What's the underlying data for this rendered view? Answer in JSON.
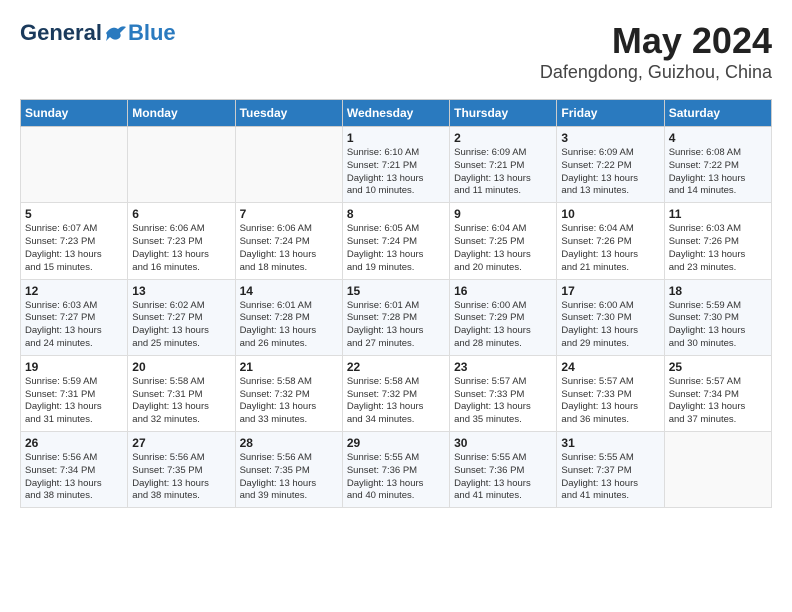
{
  "header": {
    "logo_general": "General",
    "logo_blue": "Blue",
    "title": "May 2024",
    "location": "Dafengdong, Guizhou, China"
  },
  "days_of_week": [
    "Sunday",
    "Monday",
    "Tuesday",
    "Wednesday",
    "Thursday",
    "Friday",
    "Saturday"
  ],
  "weeks": [
    [
      {
        "day": "",
        "info": ""
      },
      {
        "day": "",
        "info": ""
      },
      {
        "day": "",
        "info": ""
      },
      {
        "day": "1",
        "info": "Sunrise: 6:10 AM\nSunset: 7:21 PM\nDaylight: 13 hours\nand 10 minutes."
      },
      {
        "day": "2",
        "info": "Sunrise: 6:09 AM\nSunset: 7:21 PM\nDaylight: 13 hours\nand 11 minutes."
      },
      {
        "day": "3",
        "info": "Sunrise: 6:09 AM\nSunset: 7:22 PM\nDaylight: 13 hours\nand 13 minutes."
      },
      {
        "day": "4",
        "info": "Sunrise: 6:08 AM\nSunset: 7:22 PM\nDaylight: 13 hours\nand 14 minutes."
      }
    ],
    [
      {
        "day": "5",
        "info": "Sunrise: 6:07 AM\nSunset: 7:23 PM\nDaylight: 13 hours\nand 15 minutes."
      },
      {
        "day": "6",
        "info": "Sunrise: 6:06 AM\nSunset: 7:23 PM\nDaylight: 13 hours\nand 16 minutes."
      },
      {
        "day": "7",
        "info": "Sunrise: 6:06 AM\nSunset: 7:24 PM\nDaylight: 13 hours\nand 18 minutes."
      },
      {
        "day": "8",
        "info": "Sunrise: 6:05 AM\nSunset: 7:24 PM\nDaylight: 13 hours\nand 19 minutes."
      },
      {
        "day": "9",
        "info": "Sunrise: 6:04 AM\nSunset: 7:25 PM\nDaylight: 13 hours\nand 20 minutes."
      },
      {
        "day": "10",
        "info": "Sunrise: 6:04 AM\nSunset: 7:26 PM\nDaylight: 13 hours\nand 21 minutes."
      },
      {
        "day": "11",
        "info": "Sunrise: 6:03 AM\nSunset: 7:26 PM\nDaylight: 13 hours\nand 23 minutes."
      }
    ],
    [
      {
        "day": "12",
        "info": "Sunrise: 6:03 AM\nSunset: 7:27 PM\nDaylight: 13 hours\nand 24 minutes."
      },
      {
        "day": "13",
        "info": "Sunrise: 6:02 AM\nSunset: 7:27 PM\nDaylight: 13 hours\nand 25 minutes."
      },
      {
        "day": "14",
        "info": "Sunrise: 6:01 AM\nSunset: 7:28 PM\nDaylight: 13 hours\nand 26 minutes."
      },
      {
        "day": "15",
        "info": "Sunrise: 6:01 AM\nSunset: 7:28 PM\nDaylight: 13 hours\nand 27 minutes."
      },
      {
        "day": "16",
        "info": "Sunrise: 6:00 AM\nSunset: 7:29 PM\nDaylight: 13 hours\nand 28 minutes."
      },
      {
        "day": "17",
        "info": "Sunrise: 6:00 AM\nSunset: 7:30 PM\nDaylight: 13 hours\nand 29 minutes."
      },
      {
        "day": "18",
        "info": "Sunrise: 5:59 AM\nSunset: 7:30 PM\nDaylight: 13 hours\nand 30 minutes."
      }
    ],
    [
      {
        "day": "19",
        "info": "Sunrise: 5:59 AM\nSunset: 7:31 PM\nDaylight: 13 hours\nand 31 minutes."
      },
      {
        "day": "20",
        "info": "Sunrise: 5:58 AM\nSunset: 7:31 PM\nDaylight: 13 hours\nand 32 minutes."
      },
      {
        "day": "21",
        "info": "Sunrise: 5:58 AM\nSunset: 7:32 PM\nDaylight: 13 hours\nand 33 minutes."
      },
      {
        "day": "22",
        "info": "Sunrise: 5:58 AM\nSunset: 7:32 PM\nDaylight: 13 hours\nand 34 minutes."
      },
      {
        "day": "23",
        "info": "Sunrise: 5:57 AM\nSunset: 7:33 PM\nDaylight: 13 hours\nand 35 minutes."
      },
      {
        "day": "24",
        "info": "Sunrise: 5:57 AM\nSunset: 7:33 PM\nDaylight: 13 hours\nand 36 minutes."
      },
      {
        "day": "25",
        "info": "Sunrise: 5:57 AM\nSunset: 7:34 PM\nDaylight: 13 hours\nand 37 minutes."
      }
    ],
    [
      {
        "day": "26",
        "info": "Sunrise: 5:56 AM\nSunset: 7:34 PM\nDaylight: 13 hours\nand 38 minutes."
      },
      {
        "day": "27",
        "info": "Sunrise: 5:56 AM\nSunset: 7:35 PM\nDaylight: 13 hours\nand 38 minutes."
      },
      {
        "day": "28",
        "info": "Sunrise: 5:56 AM\nSunset: 7:35 PM\nDaylight: 13 hours\nand 39 minutes."
      },
      {
        "day": "29",
        "info": "Sunrise: 5:55 AM\nSunset: 7:36 PM\nDaylight: 13 hours\nand 40 minutes."
      },
      {
        "day": "30",
        "info": "Sunrise: 5:55 AM\nSunset: 7:36 PM\nDaylight: 13 hours\nand 41 minutes."
      },
      {
        "day": "31",
        "info": "Sunrise: 5:55 AM\nSunset: 7:37 PM\nDaylight: 13 hours\nand 41 minutes."
      },
      {
        "day": "",
        "info": ""
      }
    ]
  ]
}
